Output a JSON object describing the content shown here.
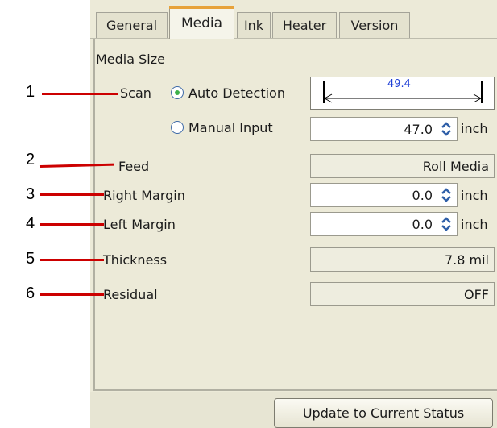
{
  "tabs": [
    "General",
    "Media",
    "Ink",
    "Heater",
    "Version"
  ],
  "active_tab": "Media",
  "section_title": "Media Size",
  "callouts": [
    "1",
    "2",
    "3",
    "4",
    "5",
    "6"
  ],
  "scan": {
    "label": "Scan",
    "auto_option": "Auto Detection",
    "manual_option": "Manual Input",
    "selected": "Auto Detection",
    "detected_value": "49.4",
    "manual_value": "47.0",
    "unit": "inch"
  },
  "feed": {
    "label": "Feed",
    "value": "Roll Media"
  },
  "right_margin": {
    "label": "Right Margin",
    "value": "0.0",
    "unit": "inch"
  },
  "left_margin": {
    "label": "Left Margin",
    "value": "0.0",
    "unit": "inch"
  },
  "thickness": {
    "label": "Thickness",
    "value": "7.8 mil"
  },
  "residual": {
    "label": "Residual",
    "value": "OFF"
  },
  "update_button": "Update to Current Status",
  "colors": {
    "callout": "#cc0000",
    "radio_dot": "#3db04b",
    "active_tab_accent": "#e7a23a",
    "detected_text": "#1f3fd6"
  }
}
